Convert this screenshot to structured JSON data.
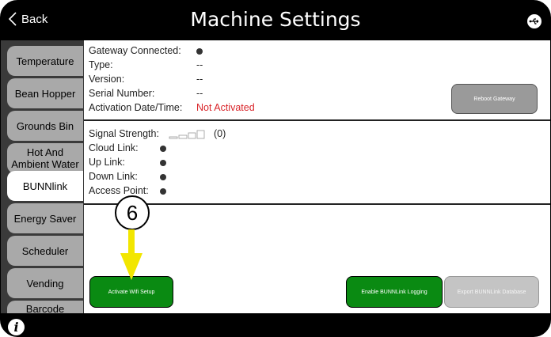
{
  "header": {
    "back_label": "Back",
    "title": "Machine Settings"
  },
  "sidebar": {
    "tabs": [
      {
        "label": "Temperature"
      },
      {
        "label": "Bean Hopper"
      },
      {
        "label": "Grounds Bin"
      },
      {
        "label": "Hot And Ambient Water"
      },
      {
        "label": "BUNNlink",
        "active": true
      },
      {
        "label": "Energy Saver"
      },
      {
        "label": "Scheduler"
      },
      {
        "label": "Vending"
      },
      {
        "label": "Barcode"
      }
    ]
  },
  "gateway": {
    "connected_label": "Gateway Connected:",
    "type_label": "Type:",
    "type_value": "--",
    "version_label": "Version:",
    "version_value": "--",
    "serial_label": "Serial Number:",
    "serial_value": "--",
    "activation_label": "Activation Date/Time:",
    "activation_value": "Not Activated",
    "reboot_label": "Reboot Gateway"
  },
  "links": {
    "signal_label": "Signal Strength:",
    "signal_value": "(0)",
    "cloud_label": "Cloud Link:",
    "up_label": "Up Link:",
    "down_label": "Down Link:",
    "ap_label": "Access Point:"
  },
  "actions": {
    "wifi_label": "Activate Wifi Setup",
    "logging_label": "Enable BUNNLink Logging",
    "export_label": "Export BUNNLink Database"
  },
  "annotation": {
    "step_number": "6"
  },
  "colors": {
    "accent_green": "#0a8a12",
    "alert_red": "#d9252a",
    "arrow_yellow": "#f2e600"
  }
}
